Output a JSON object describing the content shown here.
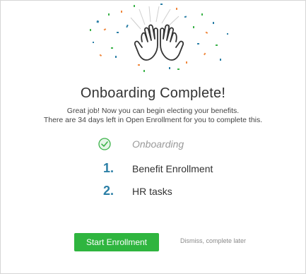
{
  "title": "Onboarding Complete!",
  "subtitle": {
    "line1": "Great job! Now you can begin electing your benefits.",
    "line2": "There are 34 days left in Open Enrollment for you to complete this."
  },
  "steps": [
    {
      "marker": "check-icon",
      "label": "Onboarding",
      "status": "complete"
    },
    {
      "marker": "1.",
      "label": "Benefit Enrollment",
      "status": "pending"
    },
    {
      "marker": "2.",
      "label": "HR tasks",
      "status": "pending"
    }
  ],
  "actions": {
    "start_label": "Start Enrollment",
    "dismiss_label": "Dismiss, complete later"
  },
  "illustration": {
    "icon": "high-five-hands-icon",
    "decor": "confetti"
  },
  "colors": {
    "primary_button": "#2fb53f",
    "step_number": "#2b7fa6",
    "check": "#3cb34a",
    "confetti": [
      "#2b7fa6",
      "#3cb34a",
      "#f0883e"
    ]
  }
}
